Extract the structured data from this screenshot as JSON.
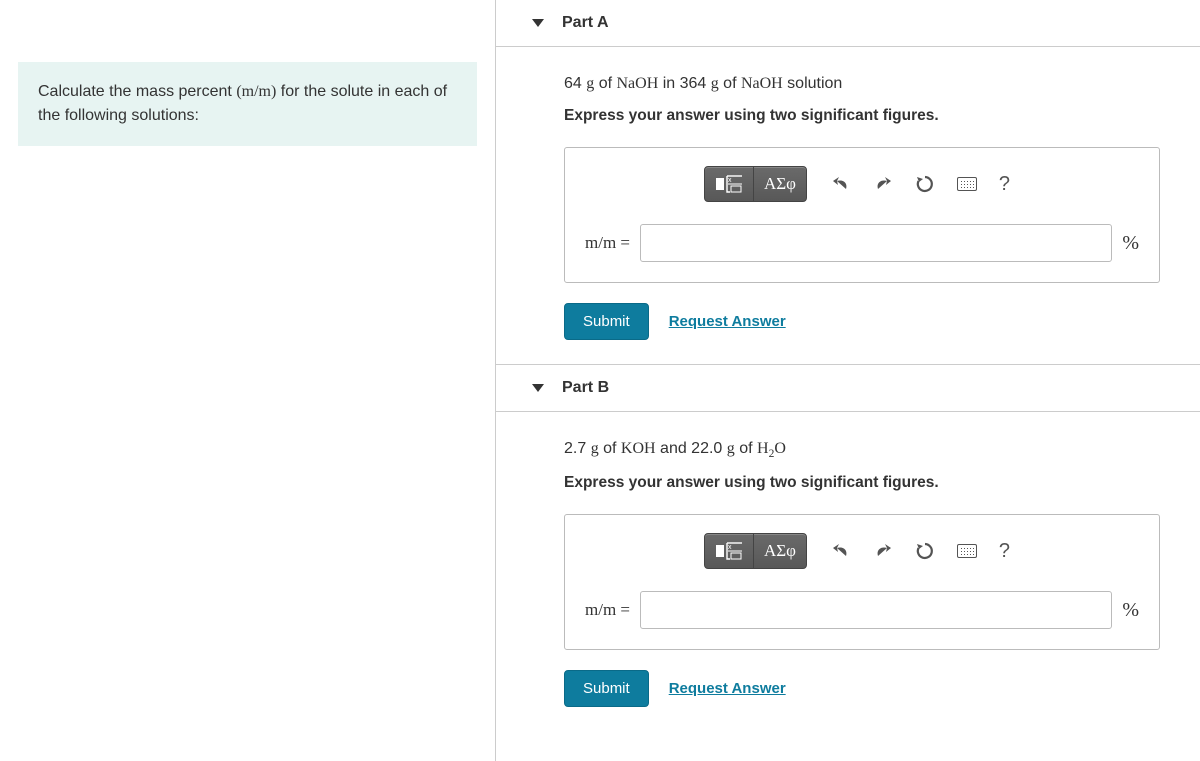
{
  "prompt": {
    "pre": "Calculate the mass percent ",
    "mm": "(m/m)",
    "post": " for the solute in each of the following solutions:"
  },
  "parts": {
    "a": {
      "title": "Part A",
      "q_pre": "64 ",
      "q_unit1": "g",
      "q_mid1": " of ",
      "q_chem1": "NaOH",
      "q_mid2": " in 364 ",
      "q_unit2": "g",
      "q_mid3": " of ",
      "q_chem2": "NaOH",
      "q_post": " solution",
      "instruction": "Express your answer using two significant figures.",
      "answer_label": "m/m =",
      "answer_unit": "%",
      "submit": "Submit",
      "request": "Request Answer"
    },
    "b": {
      "title": "Part B",
      "q_pre": "2.7 ",
      "q_unit1": "g",
      "q_mid1": " of ",
      "q_chem1": "KOH",
      "q_mid2": " and 22.0 ",
      "q_unit2": "g",
      "q_mid3": " of ",
      "q_chem2_pre": "H",
      "q_chem2_sub": "2",
      "q_chem2_post": "O",
      "instruction": "Express your answer using two significant figures.",
      "answer_label": "m/m =",
      "answer_unit": "%",
      "submit": "Submit",
      "request": "Request Answer"
    }
  },
  "toolbar": {
    "greek": "ΑΣφ",
    "help": "?"
  }
}
